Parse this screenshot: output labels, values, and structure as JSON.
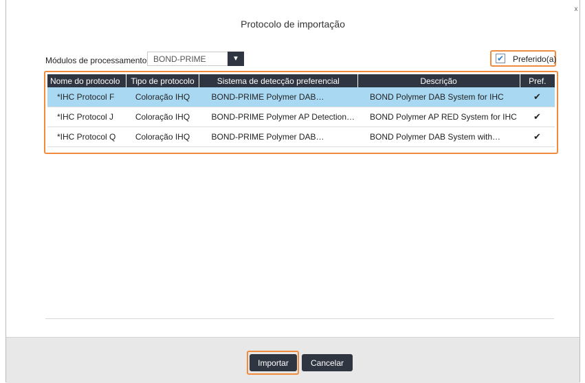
{
  "dialog": {
    "title": "Protocolo de importação",
    "close_glyph": "x"
  },
  "modules": {
    "label": "Módulos de processamento",
    "selected": "BOND-PRIME",
    "arrow_icon": "caret-down-icon"
  },
  "preferred_filter": {
    "label": "Preferido(a)",
    "checked": true,
    "check_glyph": "✔"
  },
  "table": {
    "columns": [
      "Nome do protocolo",
      "Tipo de protocolo",
      "Sistema de detecção preferencial",
      "Descrição",
      "Pref."
    ],
    "rows": [
      {
        "name": "*IHC Protocol F",
        "type": "Coloração IHQ",
        "system": "BOND-PRIME Polymer DAB…",
        "description": "BOND Polymer DAB System for IHC",
        "pref": "✔",
        "selected": true
      },
      {
        "name": "*IHC Protocol J",
        "type": "Coloração IHQ",
        "system": "BOND-PRIME Polymer AP Detection…",
        "description": "BOND Polymer AP RED System for IHC",
        "pref": "✔",
        "selected": false
      },
      {
        "name": "*IHC Protocol Q",
        "type": "Coloração IHQ",
        "system": "BOND-PRIME Polymer DAB…",
        "description": "BOND Polymer DAB System with…",
        "pref": "✔",
        "selected": false
      }
    ]
  },
  "footer": {
    "import_label": "Importar",
    "cancel_label": "Cancelar"
  },
  "colors": {
    "highlight": "#f08a3c",
    "header_dark": "#2f3541",
    "selected_row": "#a9d8f3"
  }
}
